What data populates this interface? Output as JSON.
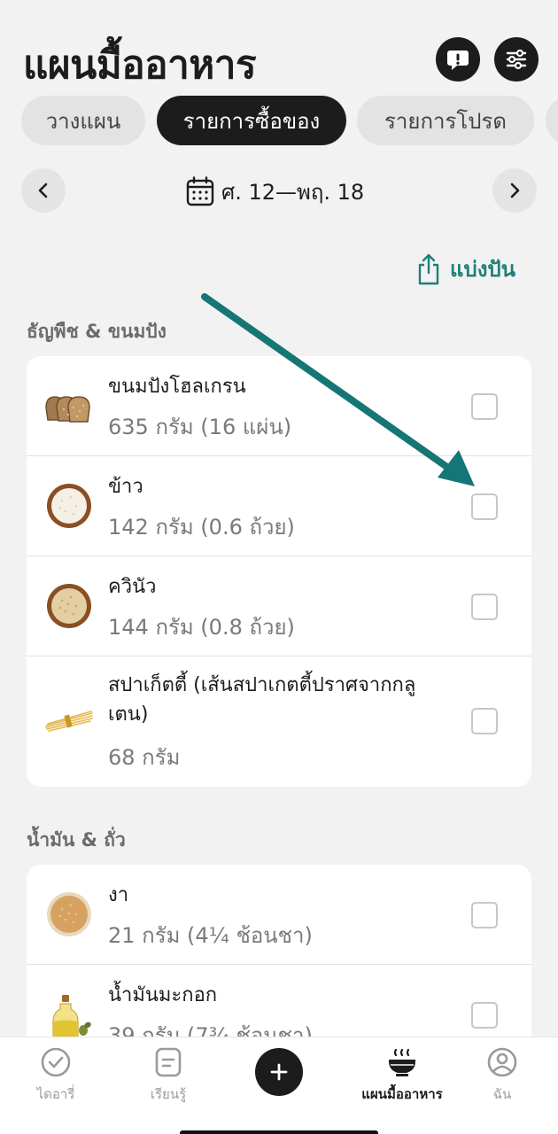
{
  "header": {
    "title": "แผนมื้ออาหาร"
  },
  "tabs": [
    {
      "label": "วางแผน",
      "active": false
    },
    {
      "label": "รายการซื้อของ",
      "active": true
    },
    {
      "label": "รายการโปรด",
      "active": false
    }
  ],
  "date_nav": {
    "range": "ศ. 12—พฤ. 18"
  },
  "share": {
    "label": "แบ่งปัน"
  },
  "sections": [
    {
      "title": "ธัญพืช & ขนมปัง",
      "items": [
        {
          "name": "ขนมปังโฮลเกรน",
          "qty": "635 กรัม (16 แผ่น)",
          "icon": "bread-icon",
          "checked": false
        },
        {
          "name": "ข้าว",
          "qty": "142 กรัม (0.6 ถ้วย)",
          "icon": "rice-bowl-icon",
          "checked": false
        },
        {
          "name": "ควินัว",
          "qty": "144 กรัม (0.8 ถ้วย)",
          "icon": "quinoa-bowl-icon",
          "checked": false
        },
        {
          "name": "สปาเก็ตตี้ (เส้นสปาเกตตี้ปราศจากกลูเตน)",
          "qty": "68 กรัม",
          "icon": "spaghetti-icon",
          "checked": false
        }
      ]
    },
    {
      "title": "น้ำมัน & ถั่ว",
      "items": [
        {
          "name": "งา",
          "qty": "21 กรัม (4¼ ช้อนชา)",
          "icon": "sesame-bowl-icon",
          "checked": false
        },
        {
          "name": "น้ำมันมะกอก",
          "qty": "39 กรัม (7¾ ช้อนชา)",
          "icon": "olive-oil-icon",
          "checked": false
        }
      ]
    }
  ],
  "bottom_nav": [
    {
      "label": "ไดอารี่",
      "icon": "check-circle-icon",
      "active": false
    },
    {
      "label": "เรียนรู้",
      "icon": "learn-card-icon",
      "active": false
    },
    {
      "label": "แผนมื้ออาหาร",
      "icon": "steaming-bowl-icon",
      "active": true
    },
    {
      "label": "ฉัน",
      "icon": "profile-icon",
      "active": false
    }
  ],
  "colors": {
    "accent": "#1e7f7a",
    "dark": "#1c1c1c",
    "background": "#f2f2f2"
  }
}
